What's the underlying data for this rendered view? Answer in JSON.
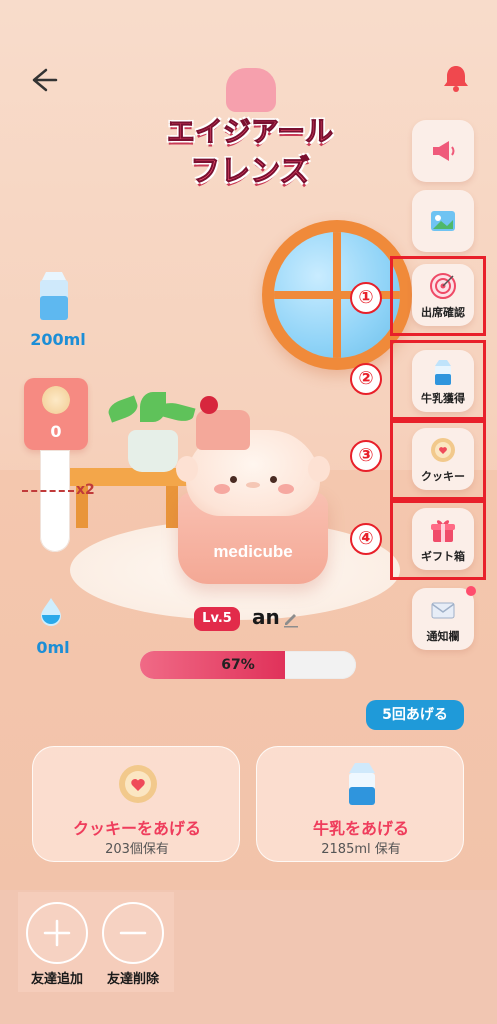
{
  "header": {
    "logo_line1": "エイジアール",
    "logo_line2": "フレンズ"
  },
  "left_panel": {
    "milk_amount": "200ml",
    "cookie_count": "0",
    "multiplier": "x2",
    "water_amount": "0ml"
  },
  "side_menu": {
    "items": [
      {
        "label": "出席確認",
        "icon": "target-icon",
        "badge": "①"
      },
      {
        "label": "牛乳獲得",
        "icon": "milk-carton-icon",
        "badge": "②"
      },
      {
        "label": "クッキー",
        "icon": "cookie-icon",
        "badge": "③"
      },
      {
        "label": "ギフト箱",
        "icon": "gift-box-icon",
        "badge": "④"
      },
      {
        "label": "通知欄",
        "icon": "envelope-icon"
      }
    ]
  },
  "character": {
    "level": "Lv.5",
    "name": "an",
    "jar_brand": "medicube",
    "progress_label": "67%",
    "progress": 0.67
  },
  "give_five_label": "5回あげる",
  "actions": {
    "cookie_title": "クッキーをあげる",
    "cookie_sub": "203個保有",
    "milk_title": "牛乳をあげる",
    "milk_sub": "2185ml 保有"
  },
  "friends": {
    "add_label": "友達追加",
    "remove_label": "友達削除"
  },
  "colors": {
    "accent_pink": "#ef3d5c",
    "accent_blue": "#1c8ed6",
    "highlight_red": "#e8202a"
  }
}
